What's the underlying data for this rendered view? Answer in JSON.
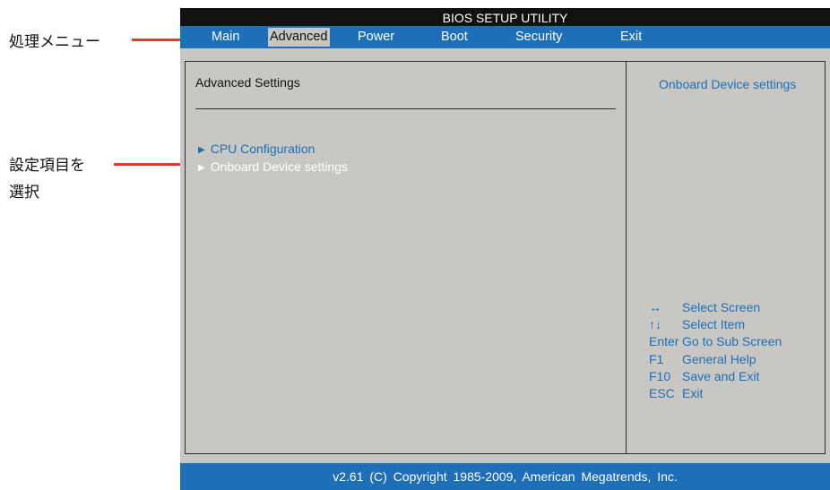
{
  "annotations": {
    "menu_label": "処理メニュー",
    "select_label_line1": "設定項目を",
    "select_label_line2": "選択",
    "line_color": "#e8372e"
  },
  "bios": {
    "title": "BIOS SETUP UTILITY",
    "menu": [
      {
        "label": "Main",
        "active": false
      },
      {
        "label": "Advanced",
        "active": true
      },
      {
        "label": "Power",
        "active": false
      },
      {
        "label": "Boot",
        "active": false
      },
      {
        "label": "Security",
        "active": false
      },
      {
        "label": "Exit",
        "active": false
      }
    ],
    "section_title": "Advanced Settings",
    "entries": [
      {
        "icon": "triangle-right-icon",
        "label": "CPU Configuration",
        "selected": false
      },
      {
        "icon": "triangle-right-icon",
        "label": "Onboard Device settings",
        "selected": true
      }
    ],
    "help_title": "Onboard Device settings",
    "keys": [
      {
        "key": "↔",
        "action": "Select Screen"
      },
      {
        "key": "↑↓",
        "action": "Select Item"
      },
      {
        "key": "Enter",
        "action": "Go to Sub Screen"
      },
      {
        "key": "F1",
        "action": "General Help"
      },
      {
        "key": "F10",
        "action": "Save and Exit"
      },
      {
        "key": "ESC",
        "action": "Exit"
      }
    ],
    "footer": "v2.61 (C) Copyright 1985-2009, American Megatrends, Inc.",
    "colors": {
      "accent": "#1d6fb8",
      "panel": "#c8c7c3",
      "titlebar": "#111111"
    }
  }
}
